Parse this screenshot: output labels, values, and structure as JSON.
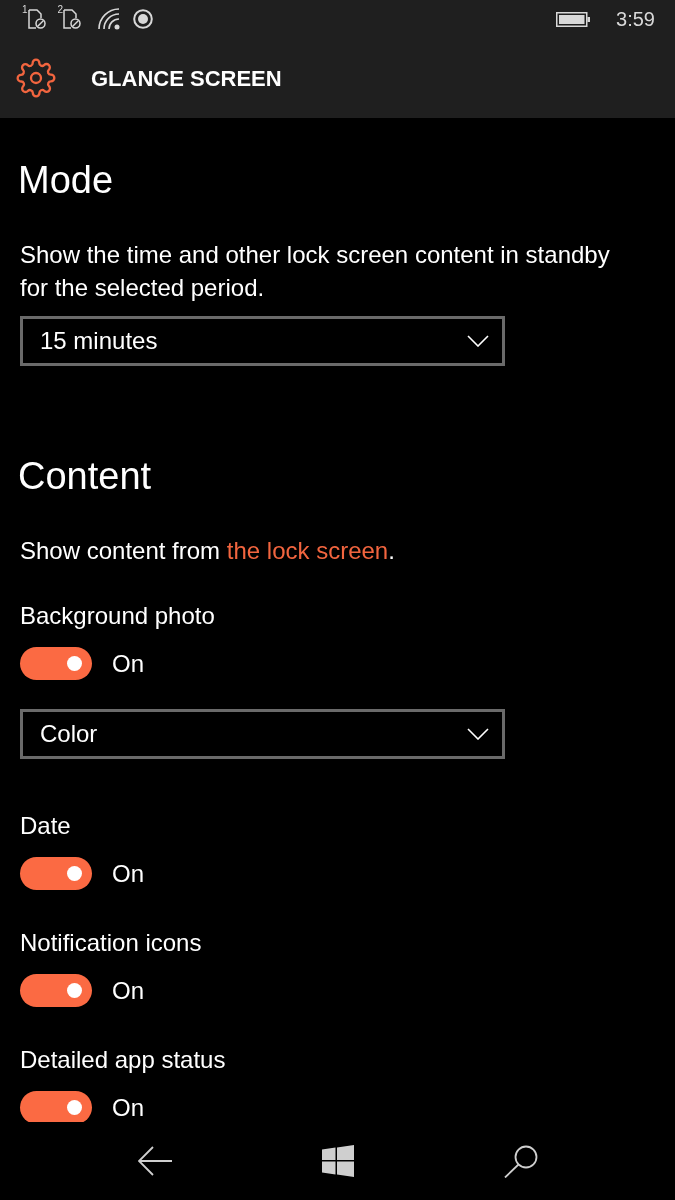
{
  "status_bar": {
    "sims": [
      {
        "label": "1"
      },
      {
        "label": "2"
      }
    ],
    "time": "3:59"
  },
  "header": {
    "title": "GLANCE SCREEN"
  },
  "sections": [
    {
      "heading": "Mode",
      "items": [
        {
          "kind": "text",
          "text": "Show the time and other lock screen content in standby for the selected period."
        },
        {
          "kind": "dropdown",
          "value": "15 minutes"
        }
      ]
    },
    {
      "heading": "Content",
      "items": [
        {
          "kind": "link_text",
          "text": "Show content from ",
          "link": "the lock screen",
          "after": "."
        },
        {
          "kind": "toggle",
          "label": "Background photo",
          "on": true,
          "state_text": "On"
        },
        {
          "kind": "dropdown",
          "value": "Color"
        },
        {
          "kind": "toggle",
          "label": "Date",
          "on": true,
          "state_text": "On"
        },
        {
          "kind": "toggle",
          "label": "Notification icons",
          "on": true,
          "state_text": "On"
        },
        {
          "kind": "toggle",
          "label": "Detailed app status",
          "on": true,
          "state_text": "On"
        }
      ]
    }
  ]
}
